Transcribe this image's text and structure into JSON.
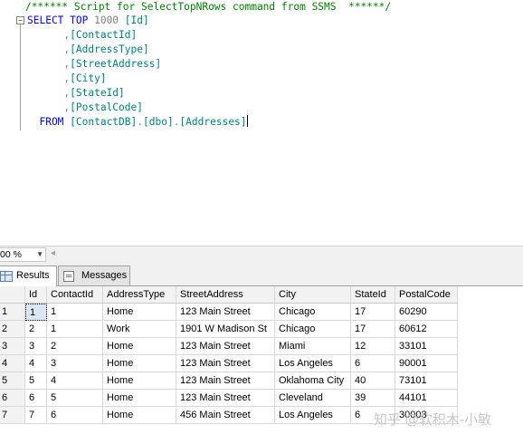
{
  "editor": {
    "lines": [
      {
        "parts": [
          {
            "t": "cm",
            "v": "/****** Script for SelectTopNRows command from SSMS  ******/"
          }
        ]
      },
      {
        "parts": [
          {
            "t": "kw",
            "v": "SELECT TOP "
          },
          {
            "t": "plain",
            "v": "1000 "
          },
          {
            "t": "ident",
            "v": "[Id]"
          }
        ]
      },
      {
        "parts": [
          {
            "t": "plain",
            "v": "      ,"
          },
          {
            "t": "ident",
            "v": "[ContactId]"
          }
        ]
      },
      {
        "parts": [
          {
            "t": "plain",
            "v": "      ,"
          },
          {
            "t": "ident",
            "v": "[AddressType]"
          }
        ]
      },
      {
        "parts": [
          {
            "t": "plain",
            "v": "      ,"
          },
          {
            "t": "ident",
            "v": "[StreetAddress]"
          }
        ]
      },
      {
        "parts": [
          {
            "t": "plain",
            "v": "      ,"
          },
          {
            "t": "ident",
            "v": "[City]"
          }
        ]
      },
      {
        "parts": [
          {
            "t": "plain",
            "v": "      ,"
          },
          {
            "t": "ident",
            "v": "[StateId]"
          }
        ]
      },
      {
        "parts": [
          {
            "t": "plain",
            "v": "      ,"
          },
          {
            "t": "ident",
            "v": "[PostalCode]"
          }
        ]
      },
      {
        "parts": [
          {
            "t": "kw",
            "v": "  FROM "
          },
          {
            "t": "ident",
            "v": "[ContactDB]"
          },
          {
            "t": "plain",
            "v": "."
          },
          {
            "t": "ident",
            "v": "[dbo]"
          },
          {
            "t": "plain",
            "v": "."
          },
          {
            "t": "ident",
            "v": "[Addresses]"
          }
        ]
      }
    ],
    "collapse_glyph": "−"
  },
  "zoom": {
    "value": "00 %",
    "arrow": "▼",
    "scroll_left": "◂"
  },
  "tabs": [
    {
      "label": "Results",
      "active": true
    },
    {
      "label": "Messages",
      "active": false
    }
  ],
  "grid": {
    "columns": [
      "Id",
      "ContactId",
      "AddressType",
      "StreetAddress",
      "City",
      "StateId",
      "PostalCode"
    ],
    "rows": [
      {
        "num": "1",
        "cells": [
          "1",
          "1",
          "Home",
          "123 Main Street",
          "Chicago",
          "17",
          "60290"
        ]
      },
      {
        "num": "2",
        "cells": [
          "2",
          "1",
          "Work",
          "1901 W Madison St",
          "Chicago",
          "17",
          "60612"
        ]
      },
      {
        "num": "3",
        "cells": [
          "3",
          "2",
          "Home",
          "123 Main Street",
          "Miami",
          "12",
          "33101"
        ]
      },
      {
        "num": "4",
        "cells": [
          "4",
          "3",
          "Home",
          "123 Main Street",
          "Los Angeles",
          "6",
          "90001"
        ]
      },
      {
        "num": "5",
        "cells": [
          "5",
          "4",
          "Home",
          "123 Main Street",
          "Oklahoma City",
          "40",
          "73101"
        ]
      },
      {
        "num": "6",
        "cells": [
          "6",
          "5",
          "Home",
          "123 Main Street",
          "Cleveland",
          "39",
          "44101"
        ]
      },
      {
        "num": "7",
        "cells": [
          "7",
          "6",
          "Home",
          "456 Main Street",
          "Los Angeles",
          "6",
          "30003"
        ]
      }
    ]
  },
  "watermark": "知乎 @软积木-小敏",
  "colors": {
    "keyword": "#0000ff",
    "comment": "#008000",
    "identifier": "#008080",
    "selected_cell": "#dbe6f4"
  }
}
